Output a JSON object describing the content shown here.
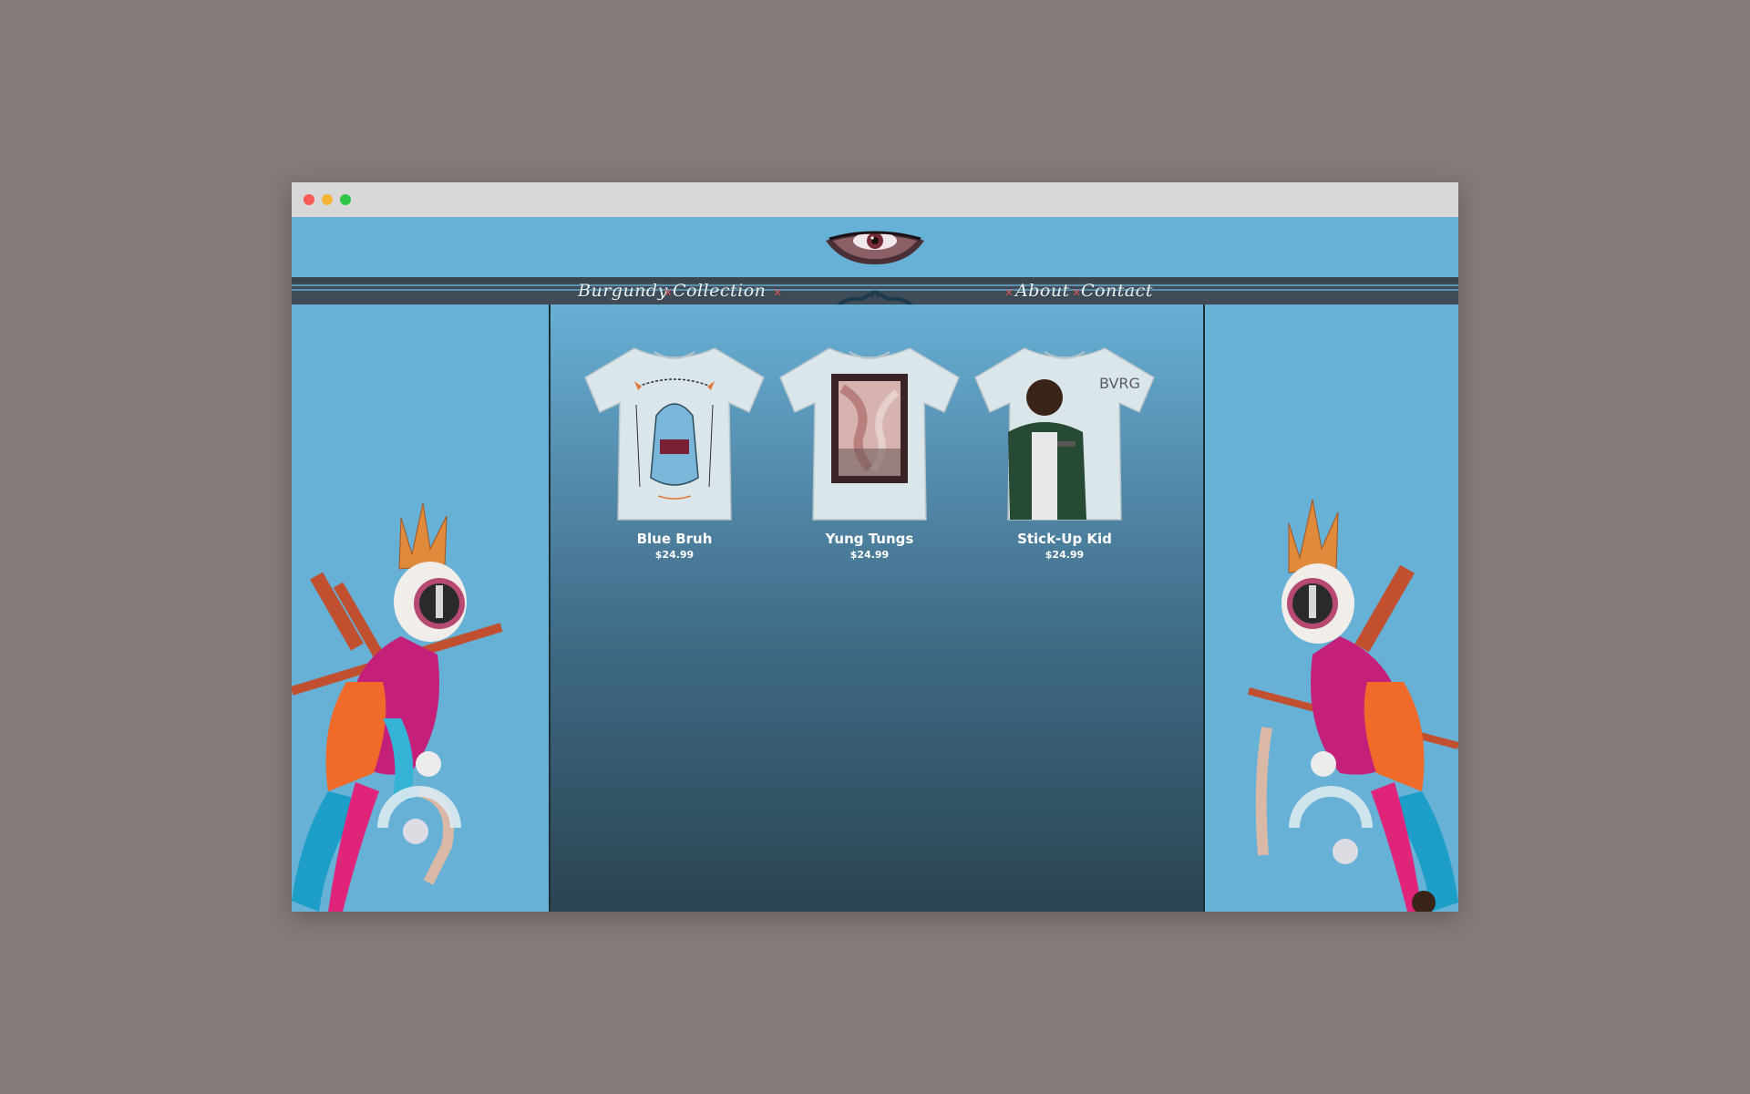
{
  "nav": {
    "left": [
      {
        "label": "Burgundy"
      },
      {
        "label": "Collection"
      }
    ],
    "right": [
      {
        "label": "About"
      },
      {
        "label": "Contact"
      }
    ],
    "separator": "✕"
  },
  "products": [
    {
      "name": "Blue Bruh",
      "price": "$24.99"
    },
    {
      "name": "Yung Tungs",
      "price": "$24.99"
    },
    {
      "name": "Stick-Up Kid",
      "price": "$24.99"
    }
  ],
  "shirt_print_text": "BVRG",
  "colors": {
    "page_bg": "#847a7a",
    "site_bg": "#67b0d6",
    "nav_band": "#3f4c57",
    "accent": "#d0545b"
  },
  "icons": [
    "eye-logo-icon",
    "ornament-icon",
    "parrot-illustration",
    "close-icon"
  ]
}
